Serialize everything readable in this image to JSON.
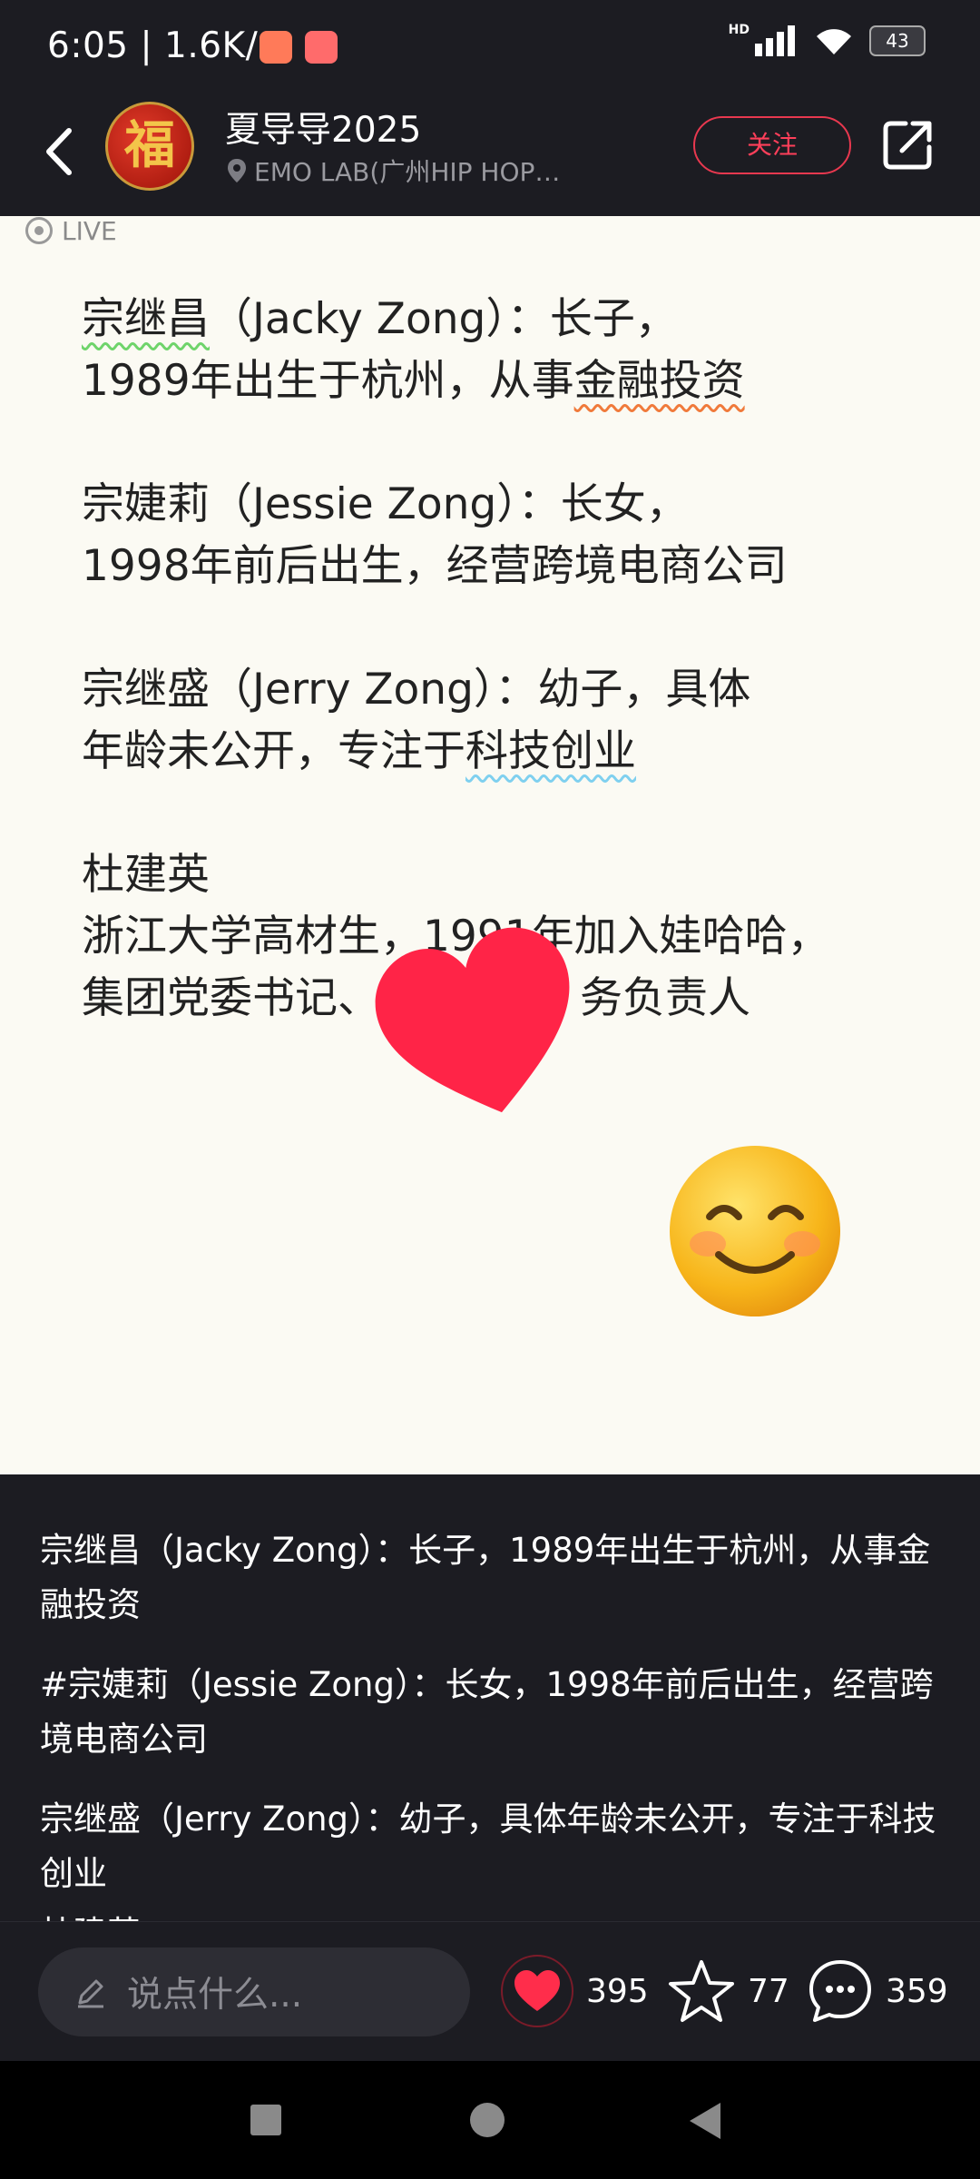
{
  "status_bar": {
    "time": "6:05 | 1.6K/s",
    "hd_label": "HD",
    "battery": "43"
  },
  "header": {
    "avatar_char": "福",
    "username": "夏导导2025",
    "location": "EMO LAB(广州HIP HOP…",
    "follow_label": "关注"
  },
  "post_image": {
    "live_label": "LIVE",
    "paragraphs": [
      {
        "line1_a": "宗继昌",
        "line1_b": "（Jacky Zong）：长子，",
        "line2_a": "1989年出生于杭州，从事",
        "line2_b": "金融投资"
      },
      {
        "line1": "宗婕莉（Jessie Zong）：长女，",
        "line2": "1998年前后出生，经营跨境电商公司"
      },
      {
        "line1": "宗继盛（Jerry Zong）：幼子，具体",
        "line2_a": "年龄未公开，专注于",
        "line2_b": "科技创业"
      },
      {
        "line1": "杜建英",
        "line2": "浙江大学高材生，1991年加入娃哈哈，",
        "line3_a": "集团党委书记、",
        "line3_b": "务负责人"
      }
    ]
  },
  "caption": {
    "p1": "宗继昌（Jacky Zong）：长子，1989年出生于杭州，从事金融投资",
    "p2": "#宗婕莉（Jessie Zong）：长女，1998年前后出生，经营跨境电商公司",
    "p3": "宗继盛（Jerry Zong）：幼子，具体年龄未公开，专注于科技创业",
    "p4": "杜建英"
  },
  "action_bar": {
    "comment_placeholder": "说点什么...",
    "likes": "395",
    "stars": "77",
    "comments": "359"
  },
  "colors": {
    "accent": "#ff2d4b",
    "background": "#1c1c22",
    "image_bg": "#fbfaf3"
  }
}
